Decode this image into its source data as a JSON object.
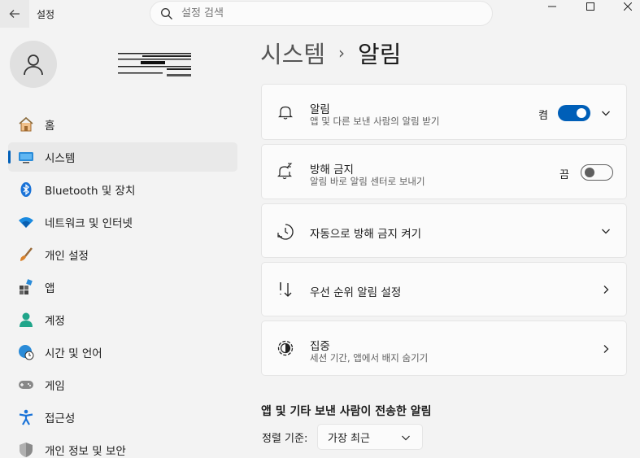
{
  "app": {
    "title": "설정"
  },
  "search": {
    "placeholder": "설정 검색"
  },
  "nav": {
    "items": [
      {
        "label": "홈",
        "icon": "home-icon"
      },
      {
        "label": "시스템",
        "icon": "system-monitor-icon"
      },
      {
        "label": "Bluetooth 및 장치",
        "icon": "bluetooth-icon"
      },
      {
        "label": "네트워크 및 인터넷",
        "icon": "wifi-icon"
      },
      {
        "label": "개인 설정",
        "icon": "brush-icon"
      },
      {
        "label": "앱",
        "icon": "apps-icon"
      },
      {
        "label": "계정",
        "icon": "account-icon"
      },
      {
        "label": "시간 및 언어",
        "icon": "globe-clock-icon"
      },
      {
        "label": "게임",
        "icon": "gamepad-icon"
      },
      {
        "label": "접근성",
        "icon": "accessibility-icon"
      },
      {
        "label": "개인 정보 및 보안",
        "icon": "shield-icon"
      }
    ],
    "active_index": 1
  },
  "breadcrumb": {
    "parent": "시스템",
    "separator": "›",
    "current": "알림"
  },
  "cards": {
    "notifications": {
      "title": "알림",
      "subtitle": "앱 및 다른 보낸 사람의 알림 받기",
      "toggle_label": "켬",
      "toggle_on": true
    },
    "dnd": {
      "title": "방해 금지",
      "subtitle": "알림 바로 알림 센터로 보내기",
      "toggle_label": "끔",
      "toggle_on": false
    },
    "auto_dnd": {
      "title": "자동으로 방해 금지 켜기"
    },
    "priority": {
      "title": "우선 순위 알림 설정"
    },
    "focus": {
      "title": "집중",
      "subtitle": "세션 기간, 앱에서 배지 숨기기"
    }
  },
  "senders": {
    "header": "앱 및 기타 보낸 사람이 전송한 알림",
    "sort_label": "정렬 기준:",
    "sort_value": "가장 최근"
  },
  "colors": {
    "accent": "#005fb8"
  }
}
